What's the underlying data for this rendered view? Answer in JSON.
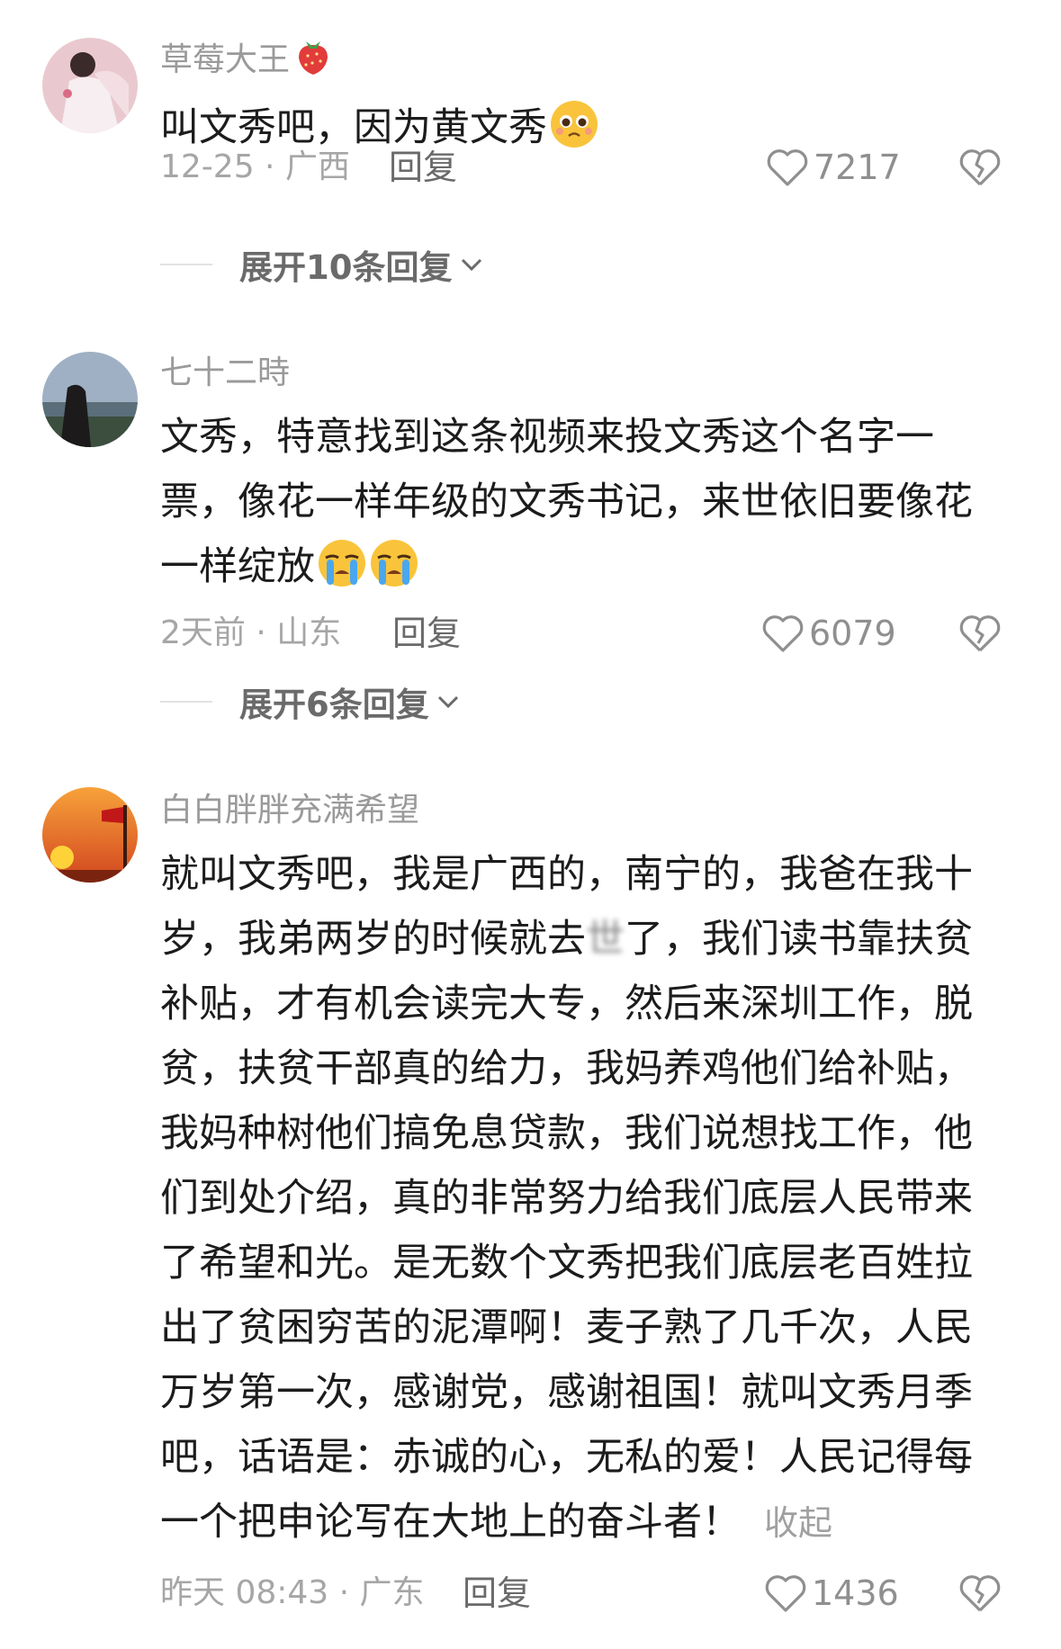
{
  "comments": [
    {
      "username": "草莓大王",
      "badge_icon": "strawberry-icon",
      "text": "叫文秀吧，因为黄文秀",
      "emojis": [
        "pleading-face-icon"
      ],
      "meta": "12-25 · 广西",
      "reply_label": "回复",
      "likes": "7217",
      "expand_label": "展开10条回复"
    },
    {
      "username": "七十二時",
      "text": "文秀，特意找到这条视频来投文秀这个名字一票，像花一样年级的文秀书记，来世依旧要像花一样绽放",
      "emojis": [
        "crying-face-icon",
        "crying-face-icon"
      ],
      "meta": "2天前 · 山东",
      "reply_label": "回复",
      "likes": "6079",
      "expand_label": "展开6条回复"
    },
    {
      "username": "白白胖胖充满希望",
      "text_before_blur": "就叫文秀吧，我是广西的，南宁的，我爸在我十岁，我弟两岁的时候就去",
      "blurred_char": "世",
      "text_after_blur": "了，我们读书靠扶贫补贴，才有机会读完大专，然后来深圳工作，脱贫，扶贫干部真的给力，我妈养鸡他们给补贴，我妈种树他们搞免息贷款，我们说想找工作，他们到处介绍，真的非常努力给我们底层人民带来了希望和光。是无数个文秀把我们底层老百姓拉出了贫困穷苦的泥潭啊！麦子熟了几千次，人民万岁第一次，感谢党，感谢祖国！就叫文秀月季吧，话语是：赤诚的心，无私的爱！人民记得每一个把申论写在大地上的奋斗者！",
      "collapse_label": "收起",
      "meta": "昨天 08:43 · 广东",
      "reply_label": "回复",
      "likes": "1436"
    }
  ],
  "colors": {
    "username": "#9a9a9a",
    "text": "#1c1c1c",
    "meta": "#a6a6a6",
    "reply": "#6a6a6a"
  }
}
